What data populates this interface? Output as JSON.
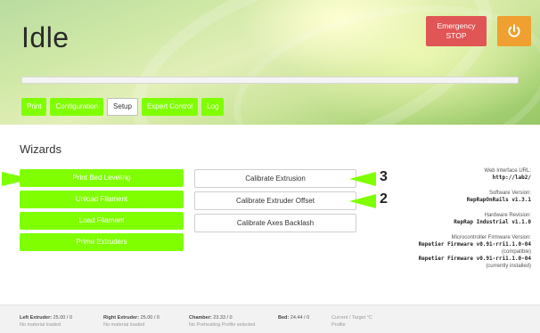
{
  "header": {
    "status": "Idle",
    "emergency_stop_line1": "Emergency",
    "emergency_stop_line2": "STOP",
    "power_icon": "power-icon",
    "progress": 1.0,
    "tabs": [
      {
        "label": "Print",
        "active": false
      },
      {
        "label": "Configuration",
        "active": false
      },
      {
        "label": "Setup",
        "active": true
      },
      {
        "label": "Expert Control",
        "active": false
      },
      {
        "label": "Log",
        "active": false
      }
    ]
  },
  "wizards": {
    "title": "Wizards",
    "left_buttons": [
      "Print Bed Leveling",
      "Unload Filament",
      "Load Filament",
      "Prime Extruders"
    ],
    "mid_buttons": [
      "Calibrate Extrusion",
      "Calibrate Extruder Offset",
      "Calibrate Axes Backlash"
    ],
    "annotations": {
      "extrusion_number": "3",
      "offset_number": "2"
    }
  },
  "info": {
    "web_url_label": "Web Interface URL:",
    "web_url": "http://lab2/",
    "software_label": "Software Version:",
    "software": "RepRapOnRails v1.3.1",
    "hardware_label": "Hardware Revision:",
    "hardware": "RepRap Industrial v1.1.0",
    "firmware_label": "Microcontroller Firmware Version:",
    "firmware_compatible": "Repetier Firmware v0.91-rri1.1.0-04",
    "compatible_note": "(compatible)",
    "firmware_installed": "Repetier Firmware v0.91-rri1.1.0-04",
    "installed_note": "(currently installed)"
  },
  "footer": {
    "left_extruder_label": "Left Extruder:",
    "left_extruder_value": "25.00 / 0",
    "left_extruder_sub": "No material loaded",
    "right_extruder_label": "Right Extruder:",
    "right_extruder_value": "25.00 / 0",
    "right_extruder_sub": "No material loaded",
    "chamber_label": "Chamber:",
    "chamber_value": "23.33 / 0",
    "chamber_sub": "No Preheating Profile selected",
    "bed_label": "Bed:",
    "bed_value": "24.44 / 0",
    "legend_label": "Current / Target °C",
    "legend_sub": "Profile"
  },
  "colors": {
    "accent": "#7fff00",
    "emergency": "#e05555",
    "power": "#f0a030"
  }
}
